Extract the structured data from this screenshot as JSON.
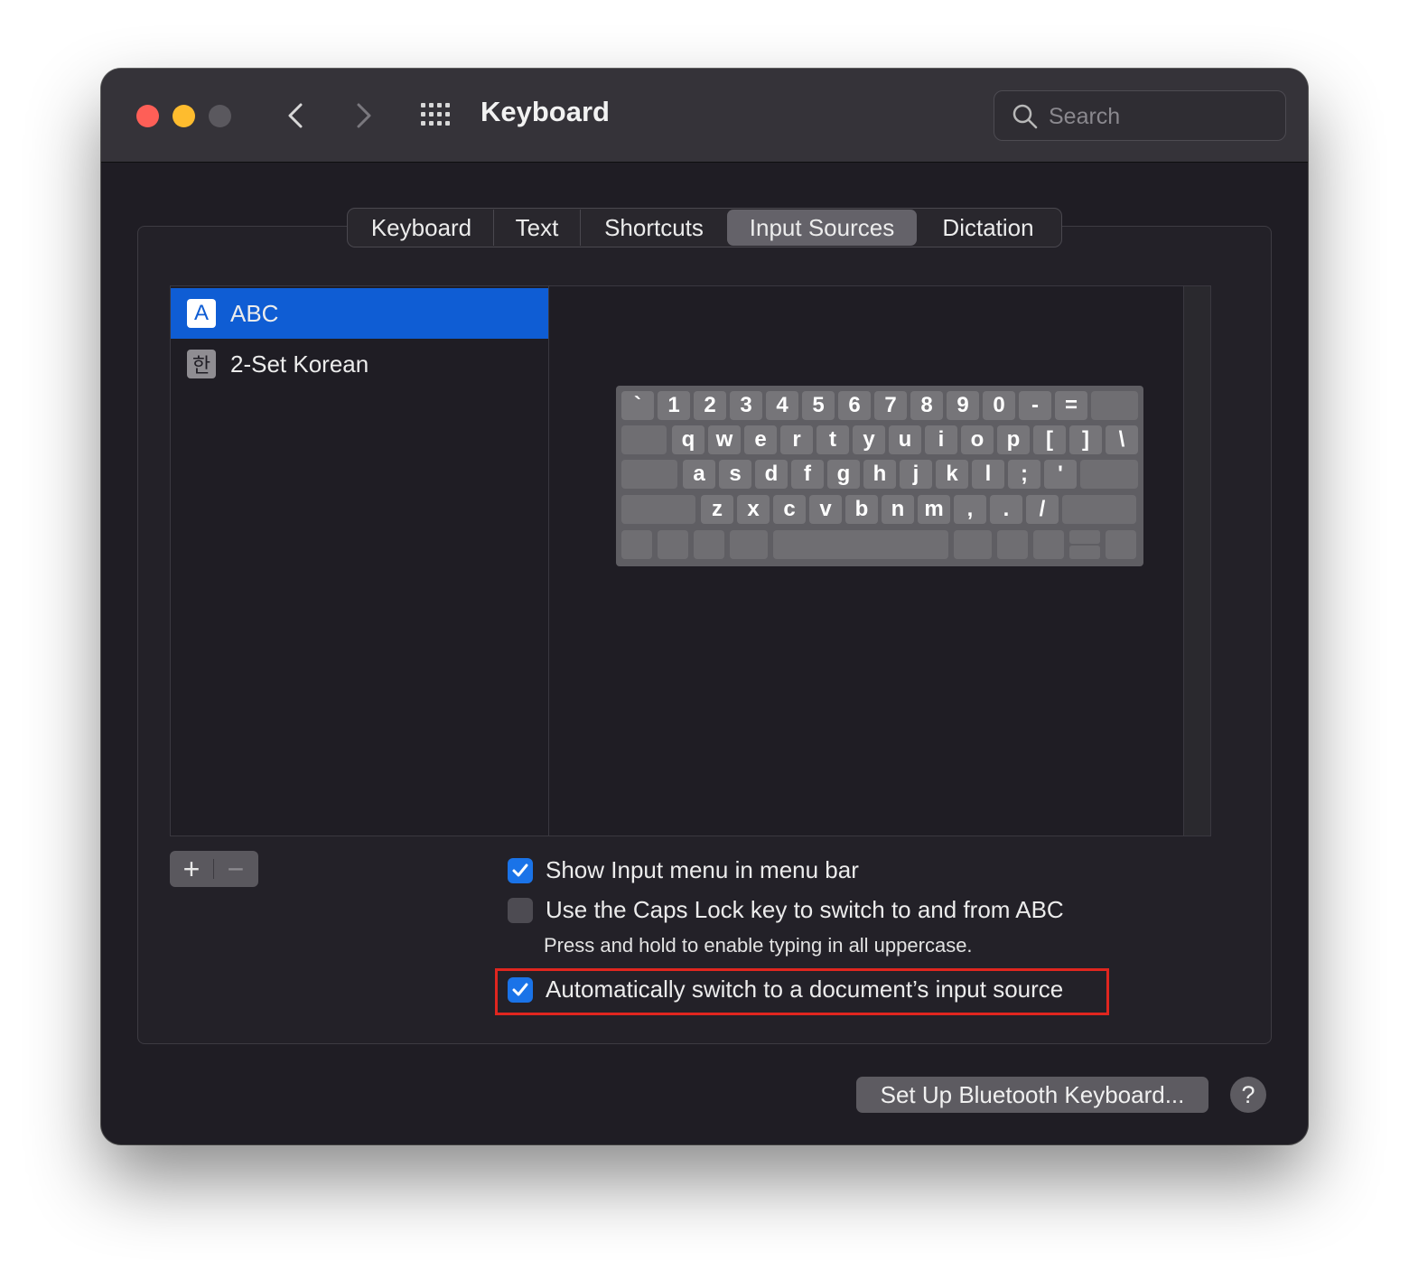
{
  "window": {
    "title": "Keyboard"
  },
  "search": {
    "placeholder": "Search"
  },
  "tabs": [
    {
      "label": "Keyboard",
      "active": false
    },
    {
      "label": "Text",
      "active": false
    },
    {
      "label": "Shortcuts",
      "active": false
    },
    {
      "label": "Input Sources",
      "active": true
    },
    {
      "label": "Dictation",
      "active": false
    }
  ],
  "input_sources": [
    {
      "icon_glyph": "A",
      "label": "ABC",
      "selected": true
    },
    {
      "icon_glyph": "한",
      "label": "2-Set Korean",
      "selected": false
    }
  ],
  "keyboard_layout": {
    "row1": [
      "`",
      "1",
      "2",
      "3",
      "4",
      "5",
      "6",
      "7",
      "8",
      "9",
      "0",
      "-",
      "="
    ],
    "row2": [
      "q",
      "w",
      "e",
      "r",
      "t",
      "y",
      "u",
      "i",
      "o",
      "p",
      "[",
      "]",
      "\\"
    ],
    "row3": [
      "a",
      "s",
      "d",
      "f",
      "g",
      "h",
      "j",
      "k",
      "l",
      ";",
      "'"
    ],
    "row4": [
      "z",
      "x",
      "c",
      "v",
      "b",
      "n",
      "m",
      ",",
      ".",
      "/"
    ]
  },
  "list_buttons": {
    "add": "+",
    "remove": "−"
  },
  "options": {
    "show_input_menu": {
      "label": "Show Input menu in menu bar",
      "checked": true
    },
    "caps_lock_switch": {
      "label": "Use the Caps Lock key to switch to and from ABC",
      "checked": false
    },
    "caps_lock_hint": "Press and hold to enable typing in all uppercase.",
    "auto_switch": {
      "label": "Automatically switch to a document’s input source",
      "checked": true
    }
  },
  "footer": {
    "bluetooth_button": "Set Up Bluetooth Keyboard...",
    "help_button": "?"
  },
  "colors": {
    "accent": "#1a73e8",
    "selection": "#0f5dd4",
    "highlight_box": "#e0261f"
  }
}
